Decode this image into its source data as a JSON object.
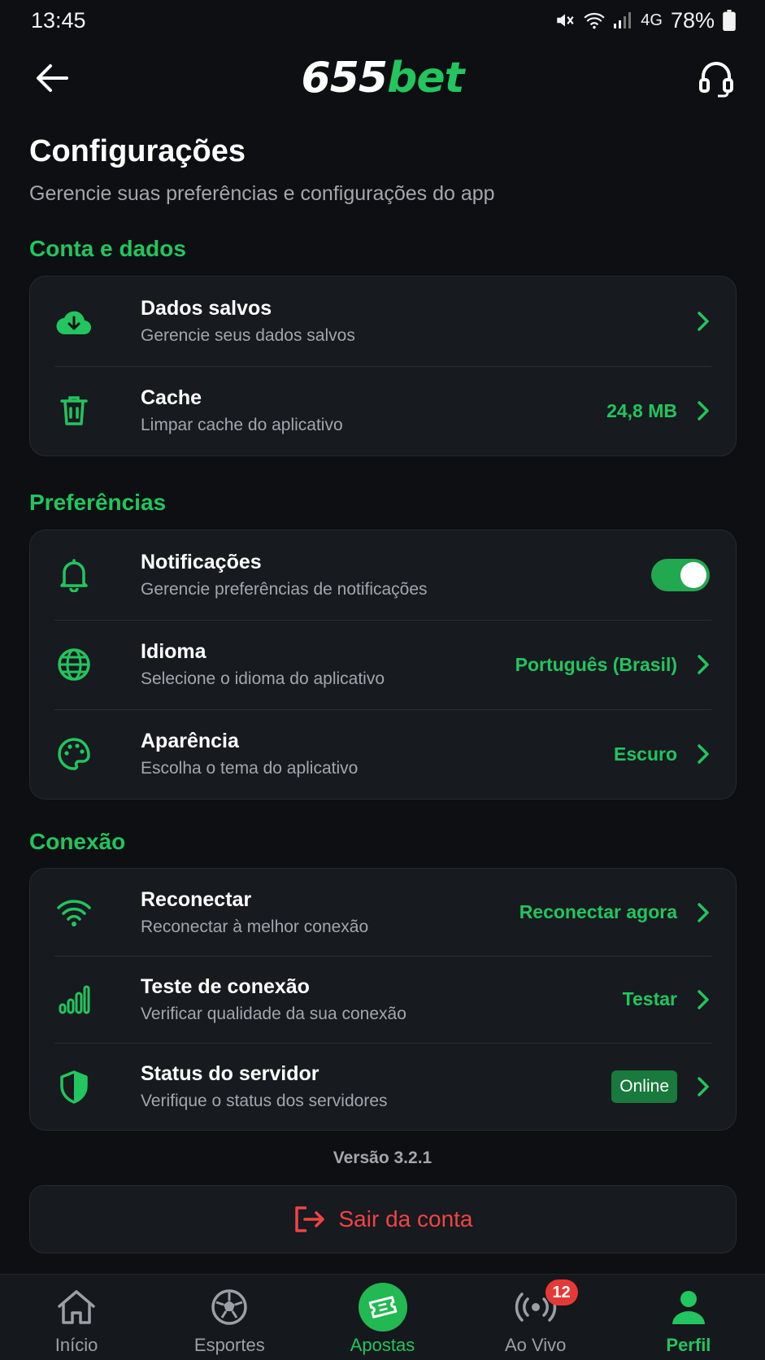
{
  "status_bar": {
    "time": "13:45",
    "battery": "78%",
    "network": "4G"
  },
  "header": {
    "logo_number": "655",
    "logo_word": "bet",
    "back_icon": "arrow-left-icon",
    "support_icon": "headset-icon"
  },
  "page": {
    "title": "Configurações",
    "subtitle": "Gerencie suas preferências e configurações do app"
  },
  "sections": {
    "account": {
      "title": "Conta e dados",
      "items": [
        {
          "title": "Dados salvos",
          "subtitle": "Gerencie seus dados salvos",
          "value": "",
          "icon": "cloud-download-icon"
        },
        {
          "title": "Cache",
          "subtitle": "Limpar cache do aplicativo",
          "value": "24,8 MB",
          "icon": "trash-icon"
        }
      ]
    },
    "preferences": {
      "title": "Preferências",
      "items": [
        {
          "title": "Notificações",
          "subtitle": "Gerencie preferências de notificações",
          "toggle_on": true,
          "icon": "bell-icon"
        },
        {
          "title": "Idioma",
          "subtitle": "Selecione o idioma do aplicativo",
          "value": "Português (Brasil)",
          "icon": "globe-icon"
        },
        {
          "title": "Aparência",
          "subtitle": "Escolha o tema do aplicativo",
          "value": "Escuro",
          "icon": "palette-icon"
        }
      ]
    },
    "connection": {
      "title": "Conexão",
      "items": [
        {
          "title": "Reconectar",
          "subtitle": "Reconectar à melhor conexão",
          "value": "Reconectar agora",
          "icon": "wifi-icon"
        },
        {
          "title": "Teste de conexão",
          "subtitle": "Verificar qualidade da sua conexão",
          "value": "Testar",
          "icon": "signal-bars-icon"
        },
        {
          "title": "Status do servidor",
          "subtitle": "Verifique o status dos servidores",
          "badge": "Online",
          "icon": "shield-icon"
        }
      ]
    }
  },
  "version": "Versão 3.2.1",
  "logout_label": "Sair da conta",
  "nav": {
    "items": [
      {
        "label": "Início",
        "icon": "home-icon"
      },
      {
        "label": "Esportes",
        "icon": "soccer-ball-icon"
      },
      {
        "label": "Apostas",
        "icon": "ticket-icon"
      },
      {
        "label": "Ao Vivo",
        "icon": "live-broadcast-icon",
        "badge": "12"
      },
      {
        "label": "Perfil",
        "icon": "person-icon"
      }
    ],
    "active": "Perfil"
  },
  "colors": {
    "background": "#0d0f12",
    "card": "#171a1f",
    "accent": "#22c55e",
    "danger": "#ef4444",
    "muted": "#a3a7ad"
  }
}
